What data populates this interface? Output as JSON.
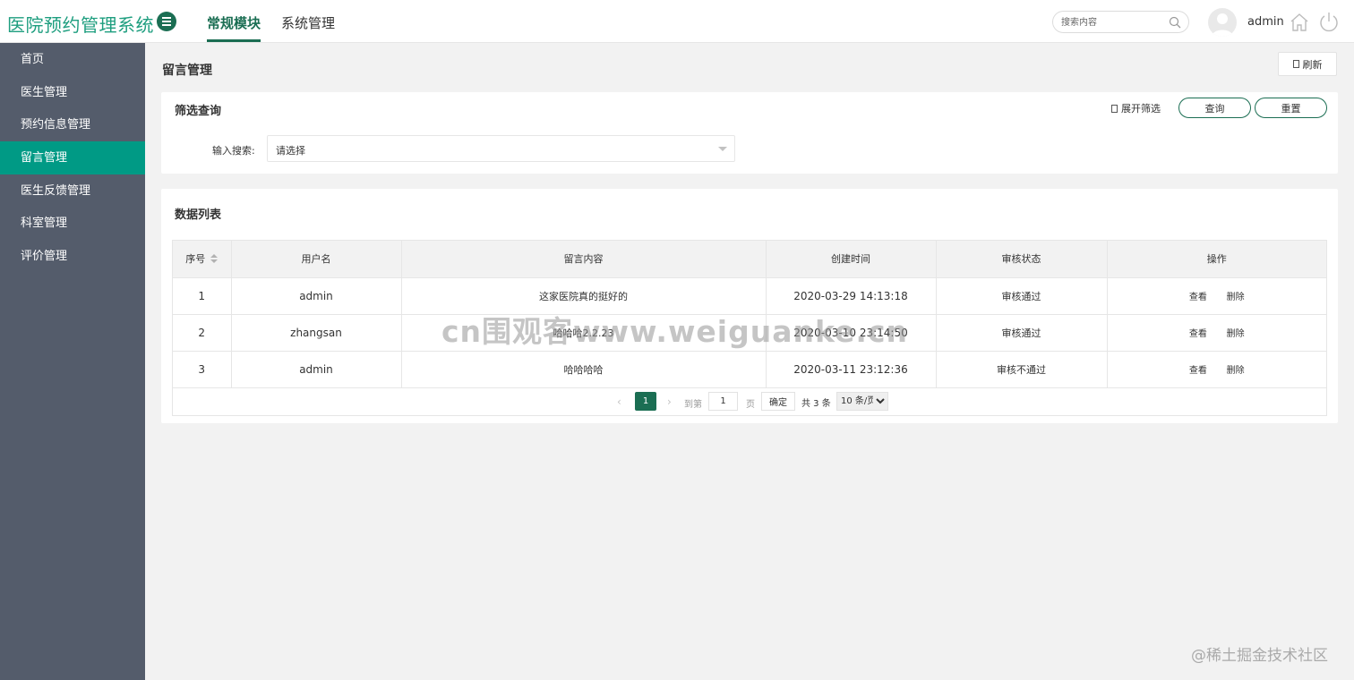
{
  "header": {
    "app_title": "医院预约管理系统",
    "tabs": [
      {
        "label": "常规模块",
        "active": true
      },
      {
        "label": "系统管理",
        "active": false
      }
    ],
    "search_placeholder": "搜索内容",
    "username": "admin"
  },
  "sidebar": {
    "items": [
      {
        "label": "首页"
      },
      {
        "label": "医生管理"
      },
      {
        "label": "预约信息管理"
      },
      {
        "label": "留言管理",
        "active": true
      },
      {
        "label": "医生反馈管理"
      },
      {
        "label": "科室管理"
      },
      {
        "label": "评价管理"
      }
    ]
  },
  "page": {
    "title": "留言管理",
    "refresh_label": "刷新"
  },
  "filter": {
    "title": "筛选查询",
    "expand_label": "展开筛选",
    "query_label": "查询",
    "reset_label": "重置",
    "field_label": "输入搜索:",
    "select_value": "请选择"
  },
  "list": {
    "title": "数据列表",
    "columns": [
      "序号",
      "用户名",
      "留言内容",
      "创建时间",
      "审核状态",
      "操作"
    ],
    "rows": [
      {
        "index": "1",
        "username": "admin",
        "content": "这家医院真的挺好的",
        "created": "2020-03-29 14:13:18",
        "status": "审核通过"
      },
      {
        "index": "2",
        "username": "zhangsan",
        "content": "哈哈哈2.2.23",
        "created": "2020-03-10 23:14:50",
        "status": "审核通过"
      },
      {
        "index": "3",
        "username": "admin",
        "content": "哈哈哈哈",
        "created": "2020-03-11 23:12:36",
        "status": "审核不通过"
      }
    ],
    "view_label": "查看",
    "delete_label": "删除"
  },
  "pagination": {
    "current_page": "1",
    "goto_label": "到第",
    "page_input": "1",
    "page_unit": "页",
    "confirm_label": "确定",
    "total_label": "共 3 条",
    "page_size": "10 条/页"
  },
  "watermark": "cn围观客www.weiguanke.cn",
  "corner_watermark": "@稀土掘金技术社区",
  "colors": {
    "brand": "#1b6e53",
    "logo_text": "#1e9e7f",
    "sidebar_bg": "#545c6b",
    "sidebar_active": "#009a85"
  }
}
